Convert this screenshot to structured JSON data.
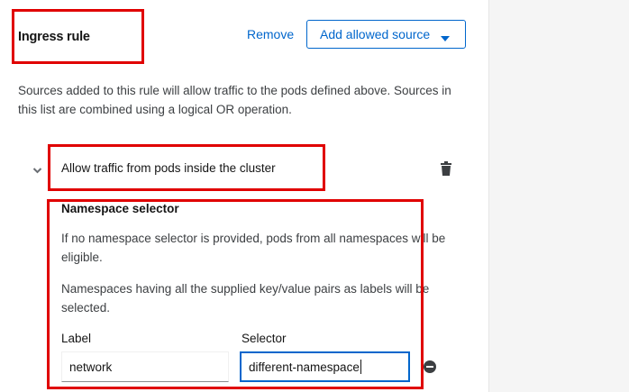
{
  "rule": {
    "title": "Ingress rule",
    "remove_label": "Remove",
    "add_source_label": "Add allowed source",
    "description": "Sources added to this rule will allow traffic to the pods defined above. Sources in this list are combined using a logical OR operation."
  },
  "peer": {
    "title": "Allow traffic from pods inside the cluster",
    "namespace_selector": {
      "heading": "Namespace selector",
      "help_1": "If no namespace selector is provided, pods from all namespaces will be eligible.",
      "help_2": "Namespaces having all the supplied key/value pairs as labels will be selected.",
      "label_header": "Label",
      "selector_header": "Selector",
      "label_value": "network",
      "selector_value": "different-namespace"
    }
  },
  "colors": {
    "link": "#0066cc",
    "annotation": "#e00000"
  },
  "icons": [
    "chevron-down-icon",
    "caret-down-icon",
    "trash-icon",
    "minus-circle-icon"
  ]
}
